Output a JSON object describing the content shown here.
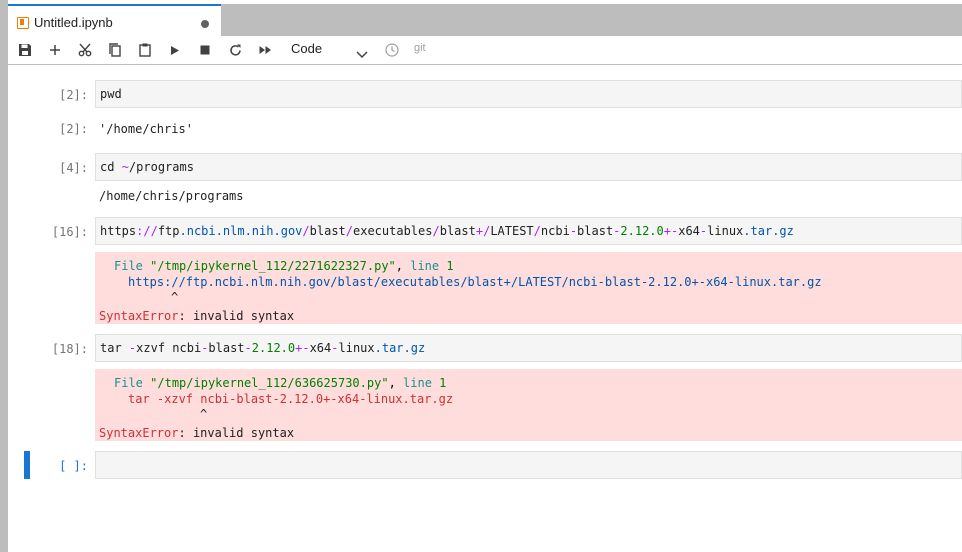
{
  "tab": {
    "title": "Untitled.ipynb",
    "icon": "notebook-icon",
    "dirty": true
  },
  "toolbar": {
    "buttons": [
      "save-icon",
      "add-icon",
      "cut-icon",
      "copy-icon",
      "paste-icon",
      "run-icon",
      "stop-icon",
      "restart-icon",
      "fast-forward-icon"
    ],
    "cell_type": "Code",
    "git_label": "git"
  },
  "cells": [
    {
      "prompt": "[2]:",
      "input": "pwd",
      "output_prompt": "[2]:",
      "output": "'/home/chris'"
    },
    {
      "prompt": "[4]:",
      "input_parts": [
        "cd ",
        "~",
        "/programs"
      ],
      "output": "/home/chris/programs"
    },
    {
      "prompt": "[16]:",
      "input_parts": [
        "https",
        "://",
        "ftp",
        ".",
        "ncbi",
        ".",
        "nlm",
        ".",
        "nih",
        ".",
        "gov",
        "/",
        "blast",
        "/",
        "executables",
        "/",
        "blast",
        "+",
        "/",
        "LATEST",
        "/",
        "ncbi",
        "-",
        "blast",
        "-",
        "2.12.0",
        "+-",
        "x64",
        "-",
        "linux",
        ".",
        "tar",
        ".",
        "gz"
      ],
      "error": {
        "file_label": "File",
        "file_path": "\"/tmp/ipykernel_112/2271622327.py\"",
        "line_label": "line",
        "line_no": "1",
        "code_line": "https://ftp.ncbi.nlm.nih.gov/blast/executables/blast+/LATEST/ncbi-blast-2.12.0+-x64-linux.tar.gz",
        "caret": "^",
        "error_type": "SyntaxError",
        "message": "invalid syntax"
      }
    },
    {
      "prompt": "[18]:",
      "input_parts": [
        "tar ",
        "-",
        "xzvf ncbi",
        "-",
        "blast",
        "-",
        "2.12.0",
        "+-",
        "x64",
        "-",
        "linux",
        ".",
        "tar",
        ".",
        "gz"
      ],
      "error": {
        "file_label": "File",
        "file_path": "\"/tmp/ipykernel_112/636625730.py\"",
        "line_label": "line",
        "line_no": "1",
        "code_line": "tar -xzvf ncbi-blast-2.12.0+-x64-linux.tar.gz",
        "caret": "^",
        "error_type": "SyntaxError",
        "message": "invalid syntax"
      }
    },
    {
      "prompt": "[ ]:",
      "input": ""
    }
  ],
  "colors": {
    "accent": "#1976d2",
    "error_bg": "#ffdddd",
    "tab_dirty": "#616161"
  }
}
